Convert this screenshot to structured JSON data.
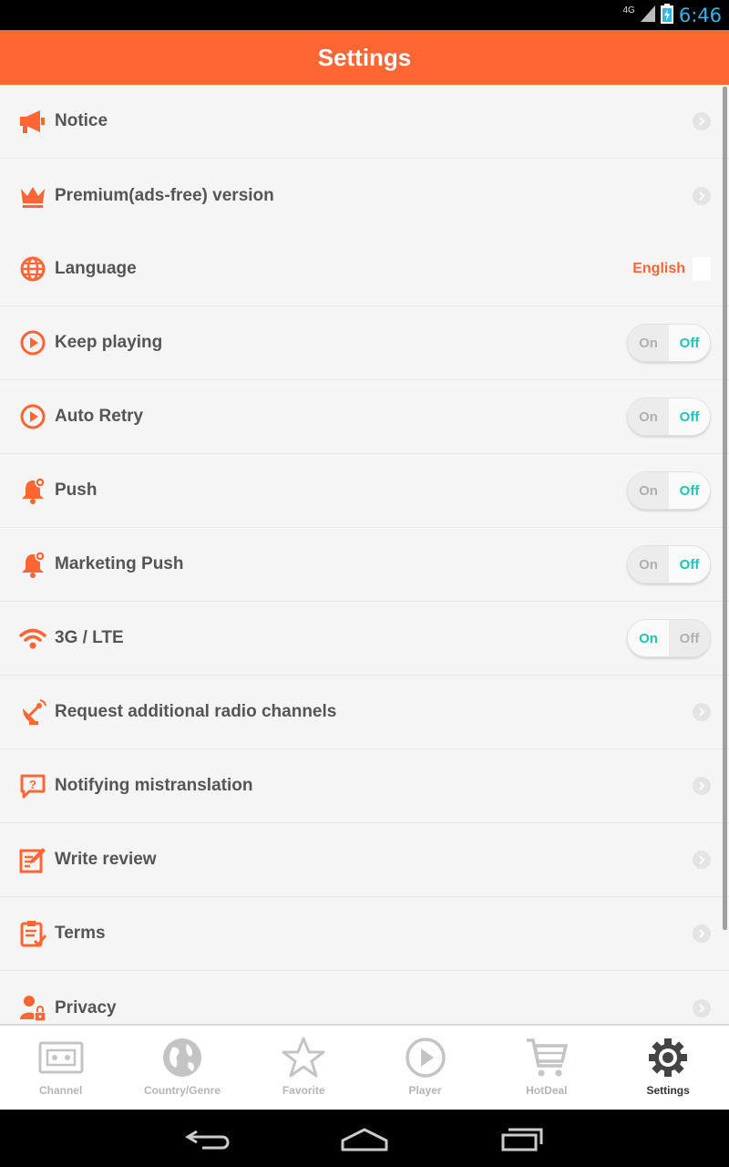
{
  "status_bar": {
    "network": "4G",
    "time": "6:46"
  },
  "header": {
    "title": "Settings"
  },
  "settings": {
    "notice": {
      "label": "Notice",
      "icon": "megaphone-icon"
    },
    "premium": {
      "label": "Premium(ads-free) version",
      "icon": "crown-icon"
    },
    "language": {
      "label": "Language",
      "value": "English",
      "icon": "globe-icon"
    },
    "keep_playing": {
      "label": "Keep playing",
      "on": "On",
      "off": "Off",
      "state": "off",
      "icon": "play-circle-icon"
    },
    "auto_retry": {
      "label": "Auto Retry",
      "on": "On",
      "off": "Off",
      "state": "off",
      "icon": "play-circle-icon"
    },
    "push": {
      "label": "Push",
      "on": "On",
      "off": "Off",
      "state": "off",
      "icon": "bell-gear-icon"
    },
    "marketing_push": {
      "label": "Marketing Push",
      "on": "On",
      "off": "Off",
      "state": "off",
      "icon": "bell-gear-icon"
    },
    "network": {
      "label": "3G / LTE",
      "on": "On",
      "off": "Off",
      "state": "on",
      "icon": "wifi-icon"
    },
    "request_channels": {
      "label": "Request additional radio channels",
      "icon": "satellite-icon"
    },
    "mistranslation": {
      "label": "Notifying mistranslation",
      "icon": "question-bubble-icon"
    },
    "write_review": {
      "label": "Write review",
      "icon": "edit-icon"
    },
    "terms": {
      "label": "Terms",
      "icon": "clipboard-icon"
    },
    "privacy": {
      "label": "Privacy",
      "icon": "user-lock-icon"
    }
  },
  "tabs": [
    {
      "label": "Channel",
      "icon": "radio-icon",
      "active": false
    },
    {
      "label": "Country/Genre",
      "icon": "earth-icon",
      "active": false
    },
    {
      "label": "Favorite",
      "icon": "star-icon",
      "active": false
    },
    {
      "label": "Player",
      "icon": "play-icon",
      "active": false
    },
    {
      "label": "HotDeal",
      "icon": "cart-icon",
      "active": false
    },
    {
      "label": "Settings",
      "icon": "gear-icon",
      "active": true
    }
  ],
  "colors": {
    "accent": "#ff6634",
    "toggle_active": "#1ec4b4",
    "clock": "#33b5e5"
  }
}
